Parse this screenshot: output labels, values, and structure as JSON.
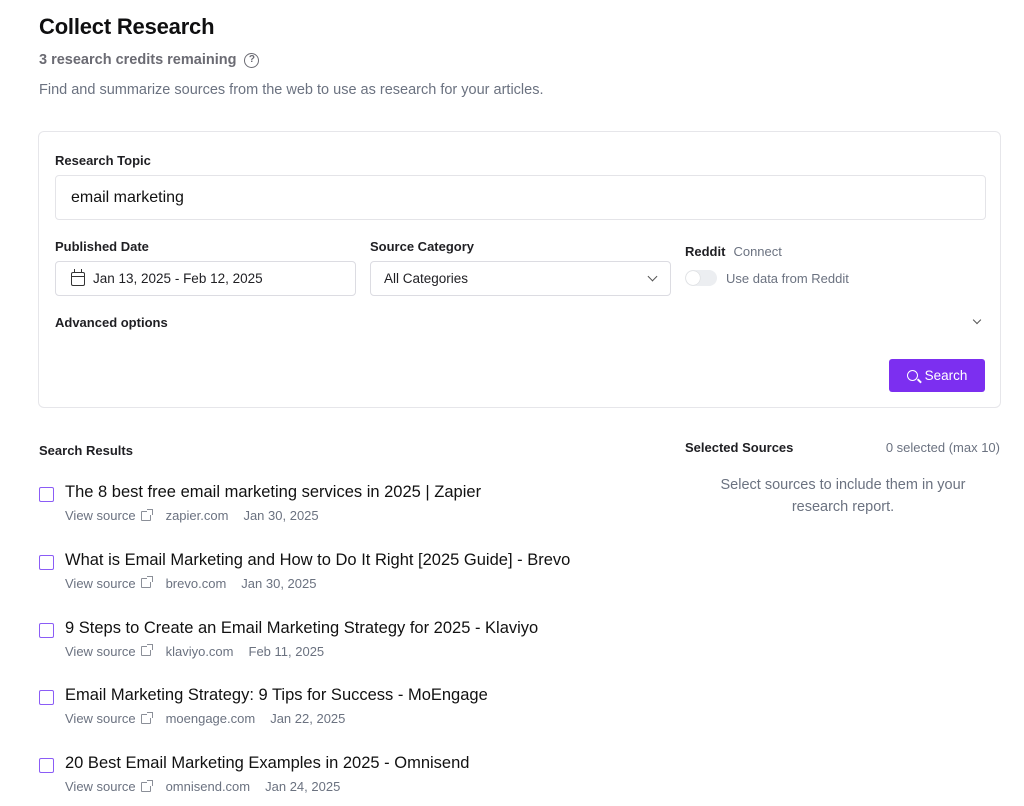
{
  "header": {
    "title": "Collect Research",
    "credits": "3 research credits remaining",
    "help_icon": "question-circle-icon",
    "subtitle": "Find and summarize sources from the web to use as research for your articles."
  },
  "form": {
    "topic_label": "Research Topic",
    "topic_value": "email marketing",
    "date_label": "Published Date",
    "date_value": "Jan 13, 2025 - Feb 12, 2025",
    "date_icon": "calendar-icon",
    "category_label": "Source Category",
    "category_value": "All Categories",
    "reddit_label": "Reddit",
    "reddit_connect": "Connect",
    "reddit_toggle_label": "Use data from Reddit",
    "reddit_toggle_on": false,
    "advanced_label": "Advanced options",
    "search_label": "Search",
    "accent_color": "#7c2ff0"
  },
  "results": {
    "heading": "Search Results",
    "view_source_label": "View source",
    "items": [
      {
        "title": "The 8 best free email marketing services in 2025 | Zapier",
        "view_source": "View source",
        "domain": "zapier.com",
        "date": "Jan 30, 2025"
      },
      {
        "title": "What is Email Marketing and How to Do It Right [2025 Guide] - Brevo",
        "view_source": "View source",
        "domain": "brevo.com",
        "date": "Jan 30, 2025"
      },
      {
        "title": "9 Steps to Create an Email Marketing Strategy for 2025 - Klaviyo",
        "view_source": "View source",
        "domain": "klaviyo.com",
        "date": "Feb 11, 2025"
      },
      {
        "title": "Email Marketing Strategy: 9 Tips for Success - MoEngage",
        "view_source": "View source",
        "domain": "moengage.com",
        "date": "Jan 22, 2025"
      },
      {
        "title": "20 Best Email Marketing Examples in 2025 - Omnisend",
        "view_source": "View source",
        "domain": "omnisend.com",
        "date": "Jan 24, 2025"
      }
    ]
  },
  "selected": {
    "heading": "Selected Sources",
    "count": "0 selected (max 10)",
    "empty_message": "Select sources to include them in your research report."
  }
}
